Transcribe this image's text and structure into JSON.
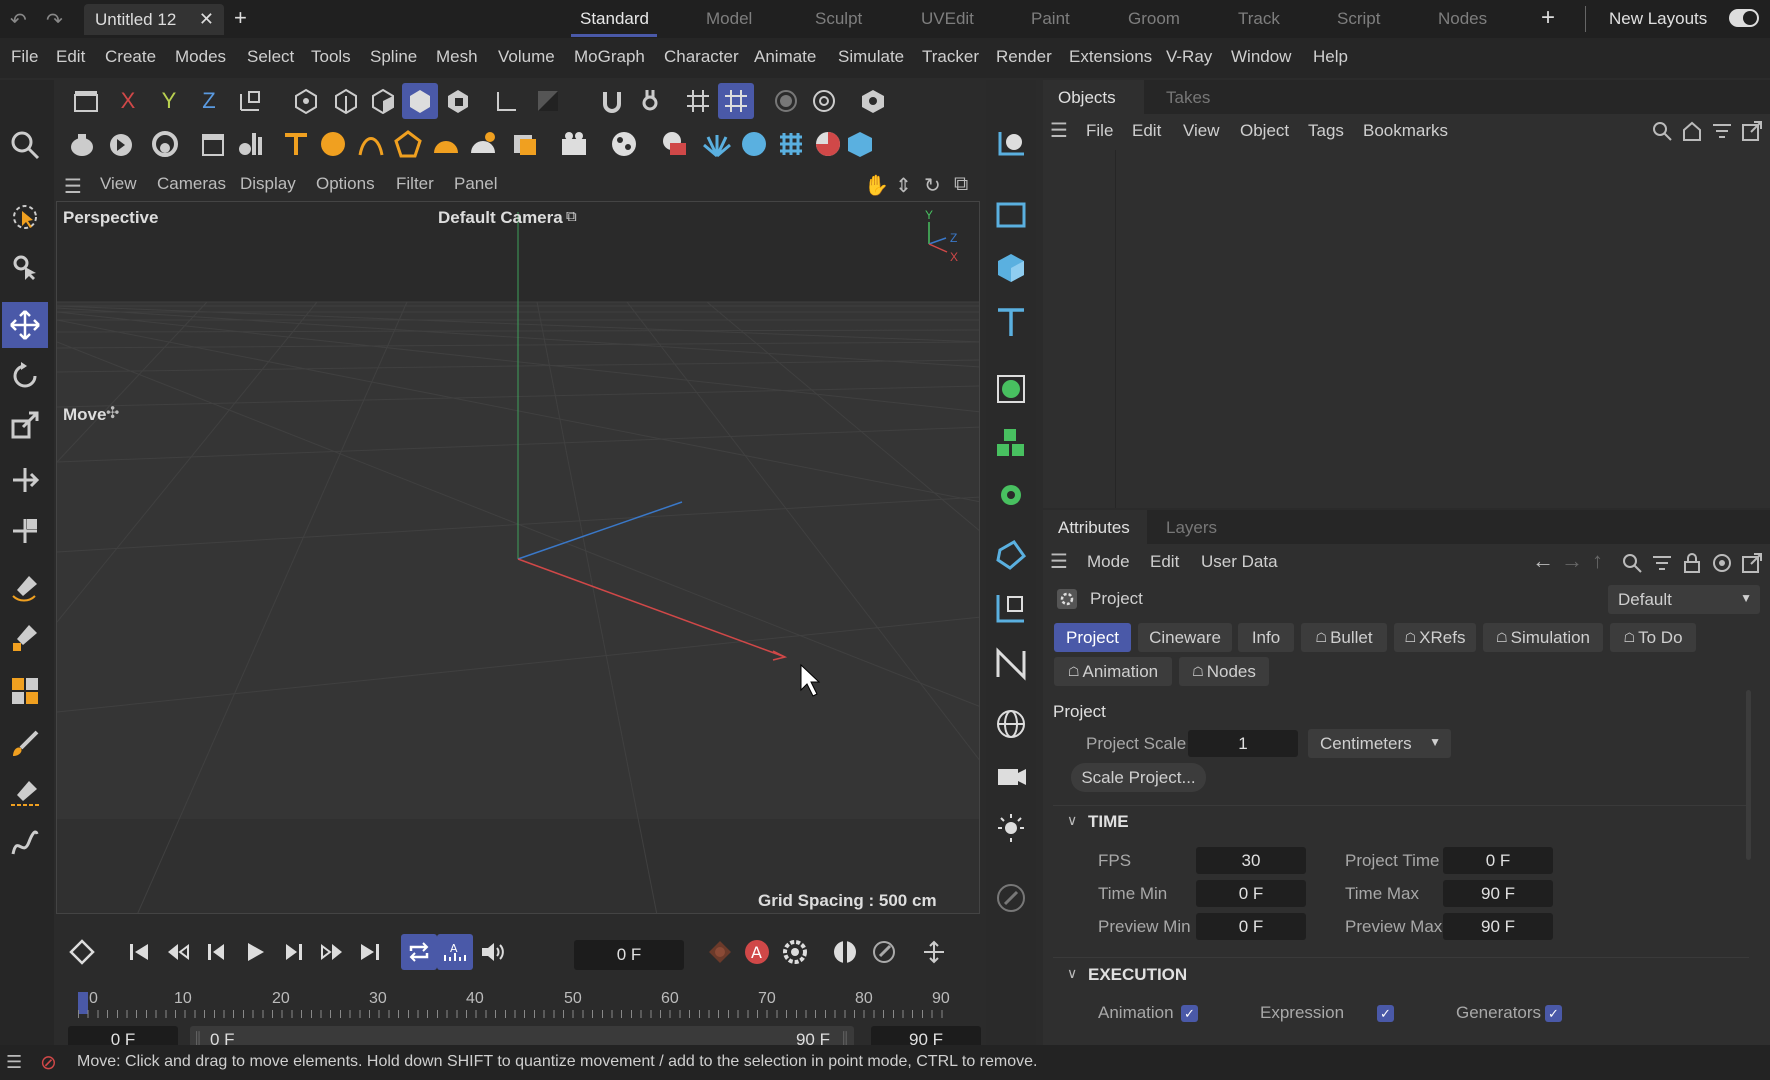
{
  "window": {
    "doc_tab": "Untitled 12",
    "new_layouts": "New Layouts"
  },
  "layouts": [
    "Standard",
    "Model",
    "Sculpt",
    "UVEdit",
    "Paint",
    "Groom",
    "Track",
    "Script",
    "Nodes"
  ],
  "menu": [
    "File",
    "Edit",
    "Create",
    "Modes",
    "Select",
    "Tools",
    "Spline",
    "Mesh",
    "Volume",
    "MoGraph",
    "Character",
    "Animate",
    "Simulate",
    "Tracker",
    "Render",
    "Extensions",
    "V-Ray",
    "Window",
    "Help"
  ],
  "toolbar": {
    "x": "X",
    "y": "Y",
    "z": "Z"
  },
  "viewport": {
    "menu": [
      "View",
      "Cameras",
      "Display",
      "Options",
      "Filter",
      "Panel"
    ],
    "name": "Perspective",
    "camera": "Default Camera",
    "tool": "Move",
    "grid": "Grid Spacing : 500 cm",
    "axis": {
      "y": "Y",
      "z": "Z",
      "x": "X"
    }
  },
  "timeline": {
    "current": "0 F",
    "ticks": [
      "0",
      "10",
      "20",
      "30",
      "40",
      "50",
      "60",
      "70",
      "80",
      "90"
    ],
    "start": "0 F",
    "range_start": "0 F",
    "range_end": "90 F",
    "end": "90 F"
  },
  "objects": {
    "tabs": [
      "Objects",
      "Takes"
    ],
    "menu": [
      "File",
      "Edit",
      "View",
      "Object",
      "Tags",
      "Bookmarks"
    ]
  },
  "attributes": {
    "tabs": [
      "Attributes",
      "Layers"
    ],
    "menu": [
      "Mode",
      "Edit",
      "User Data"
    ],
    "object": "Project",
    "preset": "Default",
    "subtabs": [
      "Project",
      "Cineware",
      "Info",
      "Bullet",
      "XRefs",
      "Simulation",
      "To Do"
    ],
    "subtabs2": [
      "Animation",
      "Nodes"
    ],
    "section": "Project",
    "scale_label": "Project Scale",
    "scale_value": "1",
    "scale_unit": "Centimeters",
    "scale_button": "Scale Project...",
    "time_header": "TIME",
    "fps_label": "FPS",
    "fps": "30",
    "ptime_label": "Project Time",
    "ptime": "0 F",
    "tmin_label": "Time Min",
    "tmin": "0 F",
    "tmax_label": "Time Max",
    "tmax": "90 F",
    "pmin_label": "Preview Min",
    "pmin": "0 F",
    "pmax_label": "Preview Max",
    "pmax": "90 F",
    "exec_header": "EXECUTION",
    "anim_label": "Animation",
    "expr_label": "Expression",
    "gen_label": "Generators"
  },
  "status": "Move: Click and drag to move elements. Hold down SHIFT to quantize movement / add to the selection in point mode, CTRL to remove.",
  "colors": {
    "accent": "#4a59a8",
    "x_axis": "#d04848",
    "y_axis": "#48c060",
    "z_axis": "#3a78c8"
  }
}
